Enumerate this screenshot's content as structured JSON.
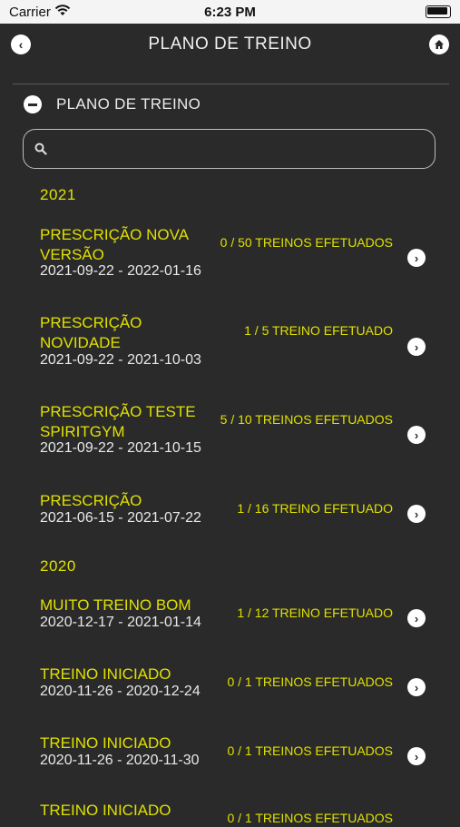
{
  "status_bar": {
    "carrier": "Carrier",
    "time": "6:23 PM"
  },
  "nav": {
    "title": "PLANO DE TREINO"
  },
  "section": {
    "label": "PLANO DE TREINO"
  },
  "search": {
    "placeholder": "",
    "value": ""
  },
  "groups": [
    {
      "year": "2021",
      "items": [
        {
          "name": "PRESCRIÇÃO NOVA VERSÃO",
          "dates": "2021-09-22 - 2022-01-16",
          "count": "0 / 50 TREINOS EFETUADOS"
        },
        {
          "name": "PRESCRIÇÃO NOVIDADE",
          "dates": "2021-09-22 - 2021-10-03",
          "count": "1 / 5 TREINO EFETUADO"
        },
        {
          "name": "PRESCRIÇÃO TESTE SPIRITGYM",
          "dates": "2021-09-22 - 2021-10-15",
          "count": "5 / 10 TREINOS EFETUADOS"
        },
        {
          "name": "PRESCRIÇÃO",
          "dates": "2021-06-15 - 2021-07-22",
          "count": "1 / 16 TREINO EFETUADO"
        }
      ]
    },
    {
      "year": "2020",
      "items": [
        {
          "name": "MUITO TREINO BOM",
          "dates": "2020-12-17 - 2021-01-14",
          "count": "1 / 12 TREINO EFETUADO"
        },
        {
          "name": "TREINO INICIADO",
          "dates": "2020-11-26 - 2020-12-24",
          "count": "0 / 1 TREINOS EFETUADOS"
        },
        {
          "name": "TREINO INICIADO",
          "dates": "2020-11-26 - 2020-11-30",
          "count": "0 / 1 TREINOS EFETUADOS"
        },
        {
          "name": "TREINO INICIADO",
          "dates": "",
          "count": "0 / 1 TREINOS EFETUADOS"
        }
      ]
    }
  ]
}
